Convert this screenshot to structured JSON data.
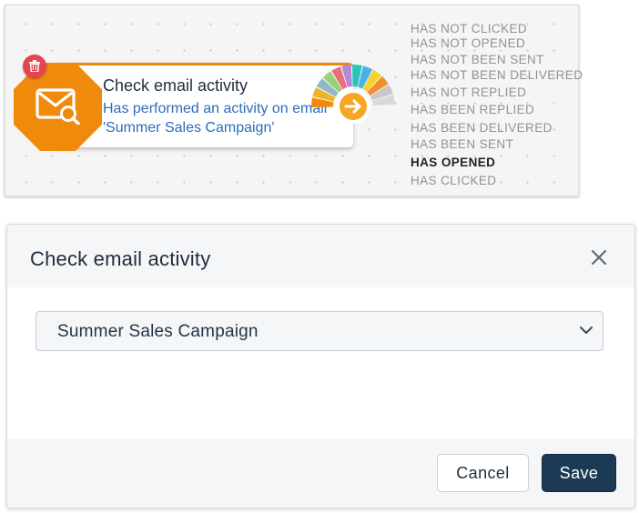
{
  "node": {
    "title": "Check email activity",
    "description": "Has performed an activity on email 'Summer Sales Campaign'",
    "icon": "email-search-icon",
    "delete_icon": "trash-icon",
    "arrow_icon": "arrow-right-icon",
    "accent_color": "#ef8a0c",
    "delete_color": "#e5454f",
    "fan_colors": [
      "#ef8a0c",
      "#f0b429",
      "#8fb8c9",
      "#9bcf7b",
      "#e8707a",
      "#b48ad8",
      "#29c5b6",
      "#4ab0e8",
      "#f5d32a",
      "#f28e2b",
      "#c8c8c8",
      "#d9d9d9"
    ]
  },
  "branches": [
    {
      "label": "HAS NOT CLICKED",
      "active": false
    },
    {
      "label": "HAS NOT OPENED",
      "active": false
    },
    {
      "label": "HAS NOT BEEN SENT",
      "active": false
    },
    {
      "label": "HAS NOT BEEN DELIVERED",
      "active": false
    },
    {
      "label": "HAS NOT REPLIED",
      "active": false
    },
    {
      "label": "HAS BEEN REPLIED",
      "active": false
    },
    {
      "label": "HAS BEEN DELIVERED",
      "active": false
    },
    {
      "label": "HAS BEEN SENT",
      "active": false
    },
    {
      "label": "HAS OPENED",
      "active": true
    },
    {
      "label": "HAS CLICKED",
      "active": false
    }
  ],
  "modal": {
    "title": "Check email activity",
    "close_icon": "close-icon",
    "select": {
      "value": "Summer Sales Campaign",
      "icon": "chevron-down-icon"
    },
    "cancel_label": "Cancel",
    "save_label": "Save",
    "save_color": "#1c3a56"
  }
}
